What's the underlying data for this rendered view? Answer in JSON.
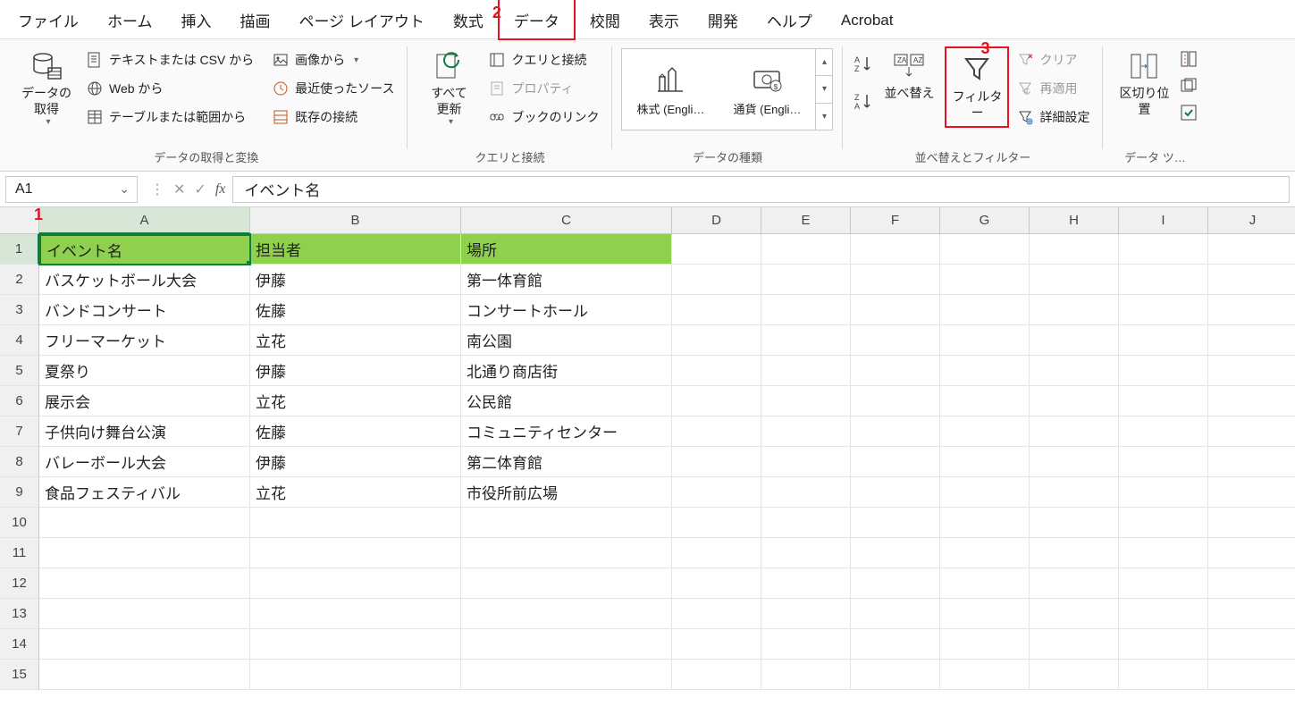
{
  "tabs": {
    "file": "ファイル",
    "home": "ホーム",
    "insert": "挿入",
    "draw": "描画",
    "layout": "ページ レイアウト",
    "formulas": "数式",
    "data": "データ",
    "review": "校閲",
    "view": "表示",
    "dev": "開発",
    "help": "ヘルプ",
    "acrobat": "Acrobat"
  },
  "annotations": {
    "a1": "1",
    "a2": "2",
    "a3": "3"
  },
  "ribbon": {
    "getdata": {
      "big": "データの\n取得",
      "txt_csv": "テキストまたは CSV から",
      "web": "Web から",
      "table": "テーブルまたは範囲から",
      "image": "画像から",
      "recent": "最近使ったソース",
      "existing": "既存の接続",
      "group": "データの取得と変換"
    },
    "queries": {
      "refresh": "すべて\n更新",
      "qc": "クエリと接続",
      "prop": "プロパティ",
      "links": "ブックのリンク",
      "group": "クエリと接続"
    },
    "types": {
      "stock": "株式 (Engli…",
      "currency": "通貨 (Engli…",
      "group": "データの種類"
    },
    "sort": {
      "sort": "並べ替え",
      "filter": "フィルター",
      "clear": "クリア",
      "reapply": "再適用",
      "advanced": "詳細設定",
      "group": "並べ替えとフィルター"
    },
    "tools": {
      "split": "区切り位置",
      "group": "データ ツ…"
    }
  },
  "namebox": "A1",
  "formula": "イベント名",
  "columns": [
    "A",
    "B",
    "C",
    "D",
    "E",
    "F",
    "G",
    "H",
    "I",
    "J"
  ],
  "rows": [
    "1",
    "2",
    "3",
    "4",
    "5",
    "6",
    "7",
    "8",
    "9",
    "10",
    "11",
    "12",
    "13",
    "14",
    "15"
  ],
  "table": {
    "headers": {
      "a": "イベント名",
      "b": "担当者",
      "c": "場所"
    },
    "data": [
      {
        "a": "バスケットボール大会",
        "b": "伊藤",
        "c": "第一体育館"
      },
      {
        "a": "バンドコンサート",
        "b": "佐藤",
        "c": "コンサートホール"
      },
      {
        "a": "フリーマーケット",
        "b": "立花",
        "c": "南公園"
      },
      {
        "a": "夏祭り",
        "b": "伊藤",
        "c": "北通り商店街"
      },
      {
        "a": "展示会",
        "b": "立花",
        "c": "公民館"
      },
      {
        "a": "子供向け舞台公演",
        "b": "佐藤",
        "c": "コミュニティセンター"
      },
      {
        "a": "バレーボール大会",
        "b": "伊藤",
        "c": "第二体育館"
      },
      {
        "a": "食品フェスティバル",
        "b": "立花",
        "c": "市役所前広場"
      }
    ]
  }
}
